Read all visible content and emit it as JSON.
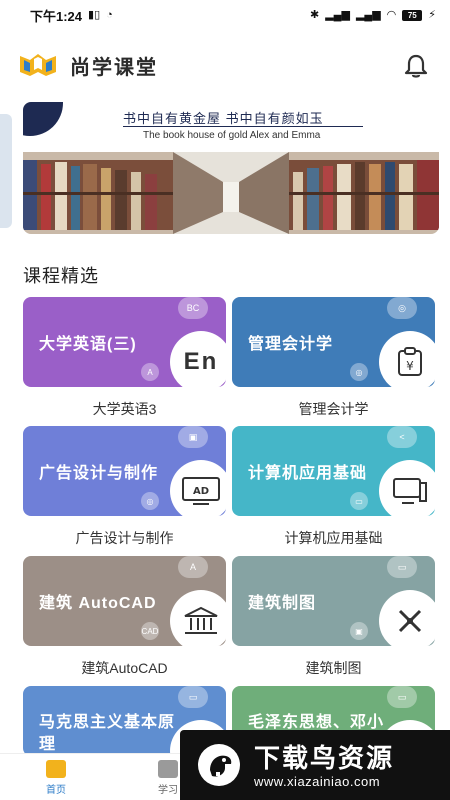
{
  "status_bar": {
    "time": "下午1:24",
    "battery": "75"
  },
  "header": {
    "app_name": "尚学课堂"
  },
  "banner": {
    "line_cn": "书中自有黄金屋   书中自有颜如玉",
    "line_en": "The book house of gold Alex and Emma"
  },
  "section": {
    "title": "课程精选"
  },
  "courses": [
    {
      "title": "大学英语(三)",
      "caption": "大学英语3",
      "badge_top": "BC",
      "badge_bottom": "A",
      "icon_text": "En",
      "color": "#9a5fc8"
    },
    {
      "title": "管理会计学",
      "caption": "管理会计学",
      "badge_top": "◎",
      "badge_bottom": "◎",
      "icon_text": "¥",
      "color": "#3f7cb8"
    },
    {
      "title": "广告设计与制作",
      "caption": "广告设计与制作",
      "badge_top": "▣",
      "badge_bottom": "◎",
      "icon_text": "AD",
      "color": "#6f7fd8"
    },
    {
      "title": "计算机应用基础",
      "caption": "计算机应用基础",
      "badge_top": "<",
      "badge_bottom": "▭",
      "icon_text": "",
      "color": "#45b6c8"
    },
    {
      "title": "建筑 AutoCAD",
      "caption": "建筑AutoCAD",
      "badge_top": "A",
      "badge_bottom": "CAD",
      "icon_text": "",
      "color": "#9c8f87"
    },
    {
      "title": "建筑制图",
      "caption": "建筑制图",
      "badge_top": "▭",
      "badge_bottom": "▣",
      "icon_text": "",
      "color": "#86a3a3"
    },
    {
      "title": "马克思主义基本原理",
      "caption": "",
      "badge_top": "▭",
      "badge_bottom": "",
      "icon_text": "",
      "color": "#5f8ed0"
    },
    {
      "title": "毛泽东思想、邓小",
      "caption": "",
      "badge_top": "▭",
      "badge_bottom": "",
      "icon_text": "",
      "color": "#6fae7a"
    }
  ],
  "bottom_nav": {
    "home": "首页",
    "study": "学习"
  },
  "watermark": {
    "title": "下载鸟资源",
    "url": "www.xiazainiao.com"
  }
}
